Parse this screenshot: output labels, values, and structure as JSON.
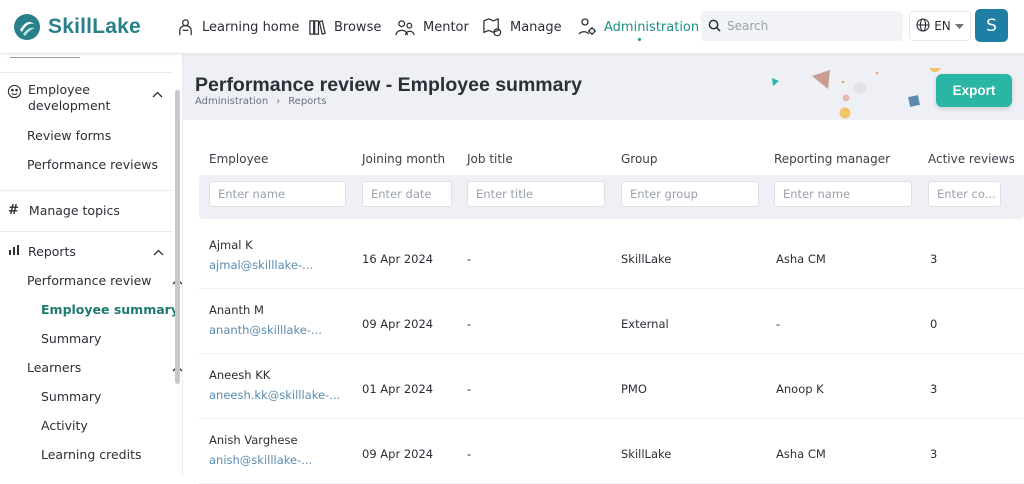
{
  "app": {
    "name": "SkillLake"
  },
  "nav": {
    "items": [
      {
        "label": "Learning home",
        "icon": "learner-icon"
      },
      {
        "label": "Browse",
        "icon": "books-icon"
      },
      {
        "label": "Mentor",
        "icon": "mentor-icon"
      },
      {
        "label": "Manage",
        "icon": "manage-icon"
      },
      {
        "label": "Administration",
        "icon": "admin-icon",
        "active": true
      }
    ],
    "search_placeholder": "Search",
    "language": "EN",
    "avatar_initial": "S"
  },
  "sidebar": {
    "employee_development": {
      "label": "Employee development",
      "icon": "emoji-icon"
    },
    "review_forms": "Review forms",
    "performance_reviews": "Performance reviews",
    "manage_topics": {
      "label": "Manage topics",
      "icon": "hash-icon"
    },
    "reports": {
      "label": "Reports",
      "icon": "bar-chart-icon"
    },
    "performance_review": "Performance review",
    "employee_summary": "Employee summary",
    "pr_summary": "Summary",
    "learners": "Learners",
    "learners_summary": "Summary",
    "activity": "Activity",
    "learning_credits": "Learning credits"
  },
  "page": {
    "title": "Performance review - Employee summary",
    "breadcrumb": [
      "Administration",
      "Reports"
    ],
    "export_label": "Export"
  },
  "table": {
    "headers": {
      "employee": "Employee",
      "joining_month": "Joining month",
      "job_title": "Job title",
      "group": "Group",
      "reporting_manager": "Reporting manager",
      "active_reviews": "Active reviews"
    },
    "filters": {
      "employee": "Enter name",
      "joining_month": "Enter date",
      "job_title": "Enter title",
      "group": "Enter group",
      "reporting_manager": "Enter name",
      "active_reviews": "Enter co..."
    },
    "rows": [
      {
        "name": "Ajmal K",
        "email": "ajmal@skilllake-...",
        "joining": "16 Apr 2024",
        "job": "-",
        "group": "SkillLake",
        "manager": "Asha CM",
        "reviews": "3"
      },
      {
        "name": "Ananth M",
        "email": "ananth@skilllake-...",
        "joining": "09 Apr 2024",
        "job": "-",
        "group": "External",
        "manager": "-",
        "reviews": "0"
      },
      {
        "name": "Aneesh KK",
        "email": "aneesh.kk@skilllake-...",
        "joining": "01 Apr 2024",
        "job": "-",
        "group": "PMO",
        "manager": "Anoop K",
        "reviews": "3"
      },
      {
        "name": "Anish Varghese",
        "email": "anish@skilllake-...",
        "joining": "09 Apr 2024",
        "job": "-",
        "group": "SkillLake",
        "manager": "Asha CM",
        "reviews": "3"
      }
    ]
  },
  "colors": {
    "brand": "#27808a",
    "accent": "#2bb5a5",
    "active_nav": "#1e8f86",
    "link": "#5b8bb0"
  }
}
